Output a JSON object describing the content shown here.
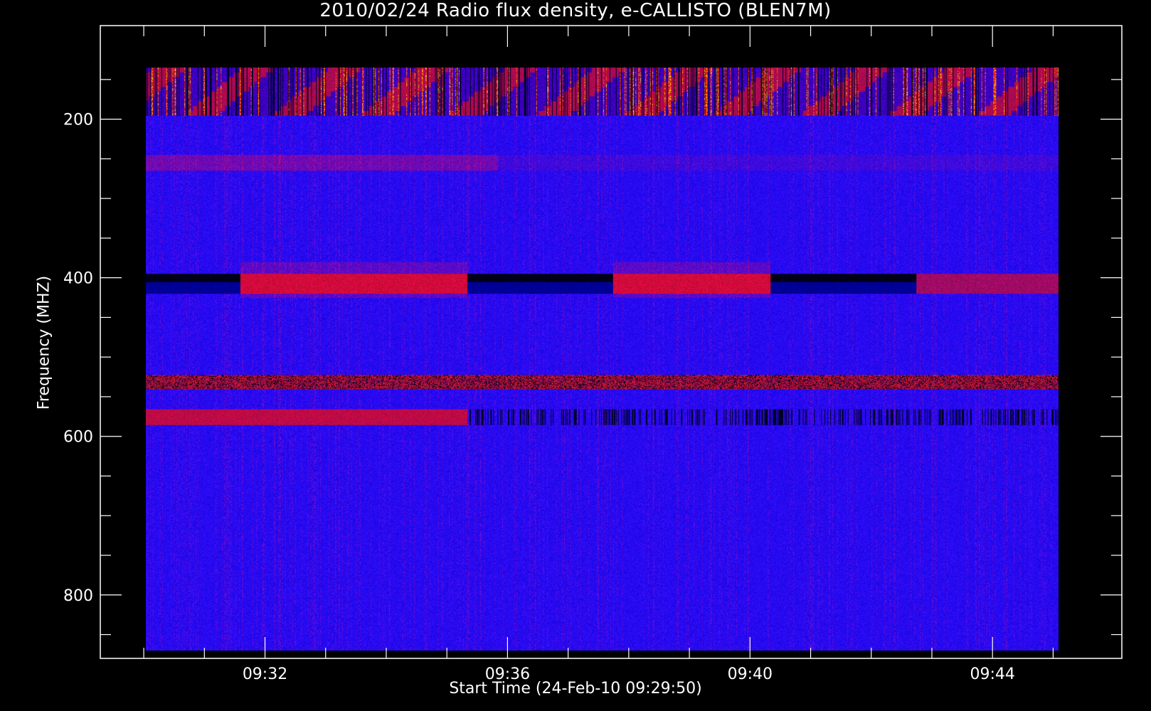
{
  "chart_data": {
    "type": "heatmap",
    "title": "2010/02/24  Radio flux density, e-CALLISTO (BLEN7M)",
    "xlabel": "Start Time (24-Feb-10 09:29:50)",
    "ylabel": "Frequency (MHZ)",
    "x_tick_labels": [
      "09:32",
      "09:36",
      "09:40",
      "09:44"
    ],
    "x_ticks_minutes": [
      2.1667,
      6.1667,
      10.1667,
      14.1667
    ],
    "x_range_minutes": [
      -0.55,
      16.3
    ],
    "data_range_minutes": [
      0.2,
      15.25
    ],
    "y_tick_labels": [
      "200",
      "400",
      "600",
      "800"
    ],
    "y_ticks": [
      200,
      400,
      600,
      800
    ],
    "ylim": [
      880,
      82
    ],
    "data_freq_range": [
      870,
      135
    ],
    "y_inverted": true,
    "colormap": [
      "#000000",
      "#0000ff",
      "#800000",
      "#ff0000",
      "#ffff00"
    ],
    "background_color": "#0a0af0",
    "features": [
      {
        "band": "400 MHz",
        "segments": [
          {
            "start": 0.2,
            "end": 1.75,
            "level": "low"
          },
          {
            "start": 1.75,
            "end": 5.5,
            "level": "high"
          },
          {
            "start": 5.5,
            "end": 7.9,
            "level": "low"
          },
          {
            "start": 7.9,
            "end": 10.5,
            "level": "high"
          },
          {
            "start": 10.5,
            "end": 12.9,
            "level": "low"
          },
          {
            "start": 12.9,
            "end": 15.25,
            "level": "high"
          }
        ]
      },
      {
        "band": "530 MHz",
        "level": "high"
      },
      {
        "band": "575 MHz",
        "level": "high",
        "fades_after": 5.5
      },
      {
        "band": "255 MHz",
        "level": "medium",
        "fades_after": 6.0
      },
      {
        "band": "135-195 MHz",
        "level": "bursty"
      }
    ]
  }
}
